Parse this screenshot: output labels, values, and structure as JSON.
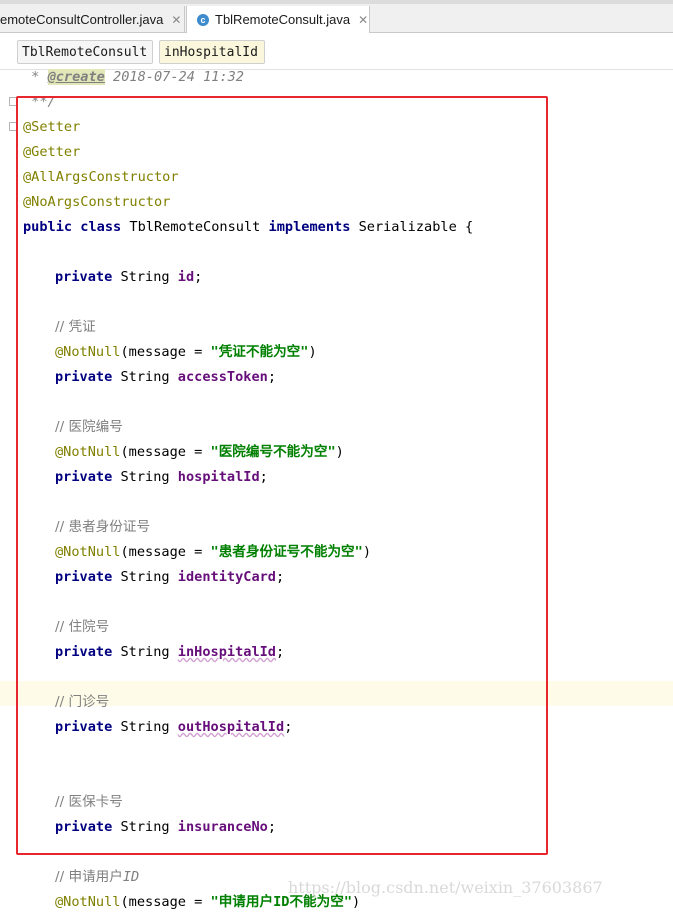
{
  "tabs": [
    {
      "label": "emoteConsultController.java",
      "close": "✕"
    },
    {
      "label": "TblRemoteConsult.java",
      "close": "✕",
      "icon": "c-class-icon"
    }
  ],
  "breadcrumb": [
    "TblRemoteConsult",
    "inHospitalId"
  ],
  "code": {
    "doc_star": " * ",
    "doc_tag": "@create",
    "doc_date": " 2018-07-24 11:32",
    "doc_end": " **/",
    "annotations": [
      "@Setter",
      "@Getter",
      "@AllArgsConstructor",
      "@NoArgsConstructor"
    ],
    "class_kw1": "public",
    "class_kw2": "class",
    "class_name": " TblRemoteConsult ",
    "implements_kw": "implements",
    "interface": " Serializable {",
    "private_kw": "private",
    "string_type": " String ",
    "semicolon": ";",
    "notnull": "@NotNull",
    "msg_open": "(message = ",
    "msg_close": ")",
    "fields": {
      "id": "id",
      "accessToken": "accessToken",
      "hospitalId": "hospitalId",
      "identityCard": "identityCard",
      "inHospitalId": "inHospitalId",
      "outHospitalId": "outHospitalId",
      "insuranceNo": "insuranceNo"
    },
    "comments": {
      "credential": "// 凭证",
      "hospital_no": "// 医院编号",
      "patient_id": "// 患者身份证号",
      "inpatient_no": "// 住院号",
      "outpatient_no": "// 门诊号",
      "insurance_card": "// 医保卡号",
      "applicant_prefix": "// 申请用户",
      "applicant_suffix": "ID"
    },
    "messages": {
      "credential": "\"凭证不能为空\"",
      "hospital_no": "\"医院编号不能为空\"",
      "patient_id": "\"患者身份证号不能为空\"",
      "applicant": "\"申请用户ID不能为空\""
    }
  },
  "watermark": "https://blog.csdn.net/weixin_37603867",
  "colors": {
    "keyword": "#000080",
    "annotation": "#808000",
    "field": "#660e7a",
    "string": "#008000",
    "comment": "#808080",
    "highlight_box": "#e8262d",
    "current_line": "#fefce8"
  }
}
